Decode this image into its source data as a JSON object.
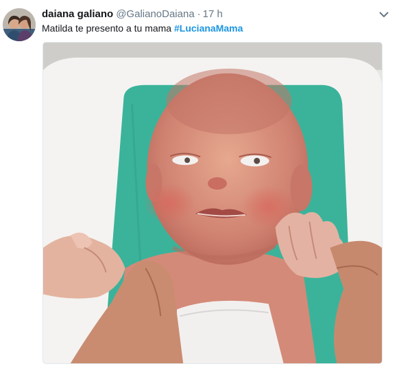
{
  "tweet": {
    "display_name": "daiana galiano",
    "handle": "@GalianoDaiana",
    "separator": "·",
    "time": "17 h",
    "text": "Matilda te presento a tu mama ",
    "hashtag": "#LucianaMama"
  },
  "icons": {
    "more": "chevron-down-icon"
  },
  "colors": {
    "hashtag": "#1b95e0",
    "secondary_text": "#657786",
    "primary_text": "#14171a"
  }
}
